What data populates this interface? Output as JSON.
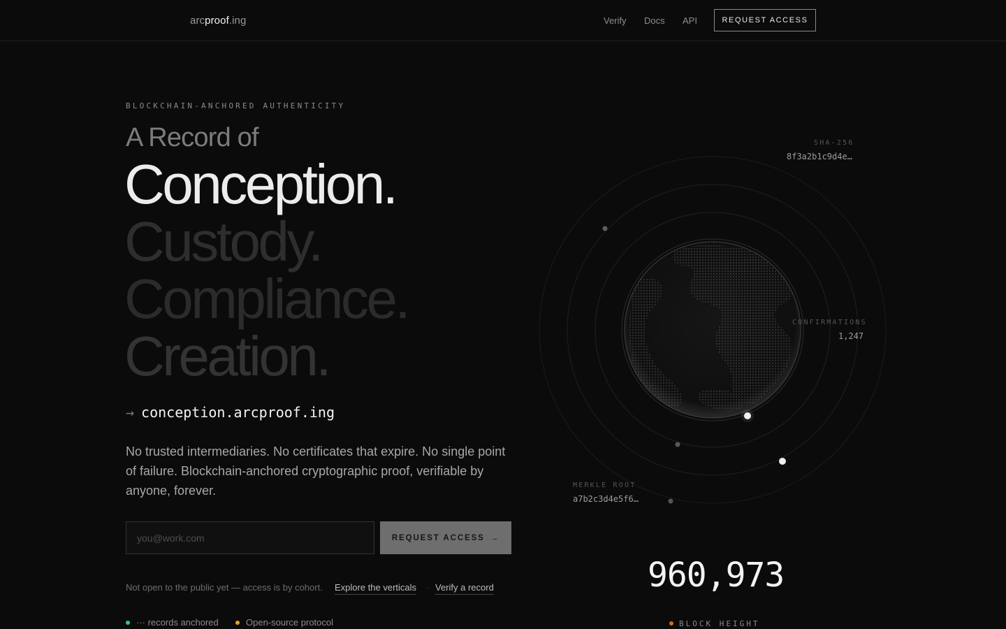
{
  "header": {
    "logo": {
      "prefix": "arc",
      "middle": "proof",
      "suffix": ".ing"
    },
    "nav": [
      "Verify",
      "Docs",
      "API"
    ],
    "cta": "REQUEST ACCESS"
  },
  "hero": {
    "eyebrow": "BLOCKCHAIN-ANCHORED AUTHENTICITY",
    "lead": "A Record of",
    "words": [
      "Conception.",
      "Custody.",
      "Compliance.",
      "Creation."
    ],
    "url_arrow": "→",
    "url": "conception.arcproof.ing",
    "description": "No trusted intermediaries. No certificates that expire. No single point of failure. Blockchain-anchored cryptographic proof, verifiable by anyone, forever.",
    "email_placeholder": "you@work.com",
    "cta": "REQUEST ACCESS",
    "cta_arrow": "→",
    "note": "Not open to the public yet — access is by cohort.",
    "link_verticals": "Explore the verticals",
    "link_verify": "Verify a record",
    "separator": "·",
    "stats": [
      {
        "label": "··· records anchored",
        "color": "#2ecc71"
      },
      {
        "label": "Open-source protocol",
        "color": "#e0a32a"
      }
    ]
  },
  "visual": {
    "sha_label": "SHA-256",
    "sha_value": "8f3a2b1c9d4e…",
    "confirmations_label": "CONFIRMATIONS",
    "confirmations_value": "1,247",
    "merkle_label": "MERKLE ROOT",
    "merkle_value": "a7b2c3d4e5f6…",
    "block_height": "960,973",
    "block_height_label": "BLOCK HEIGHT",
    "block_dot_color": "#c8741f"
  }
}
